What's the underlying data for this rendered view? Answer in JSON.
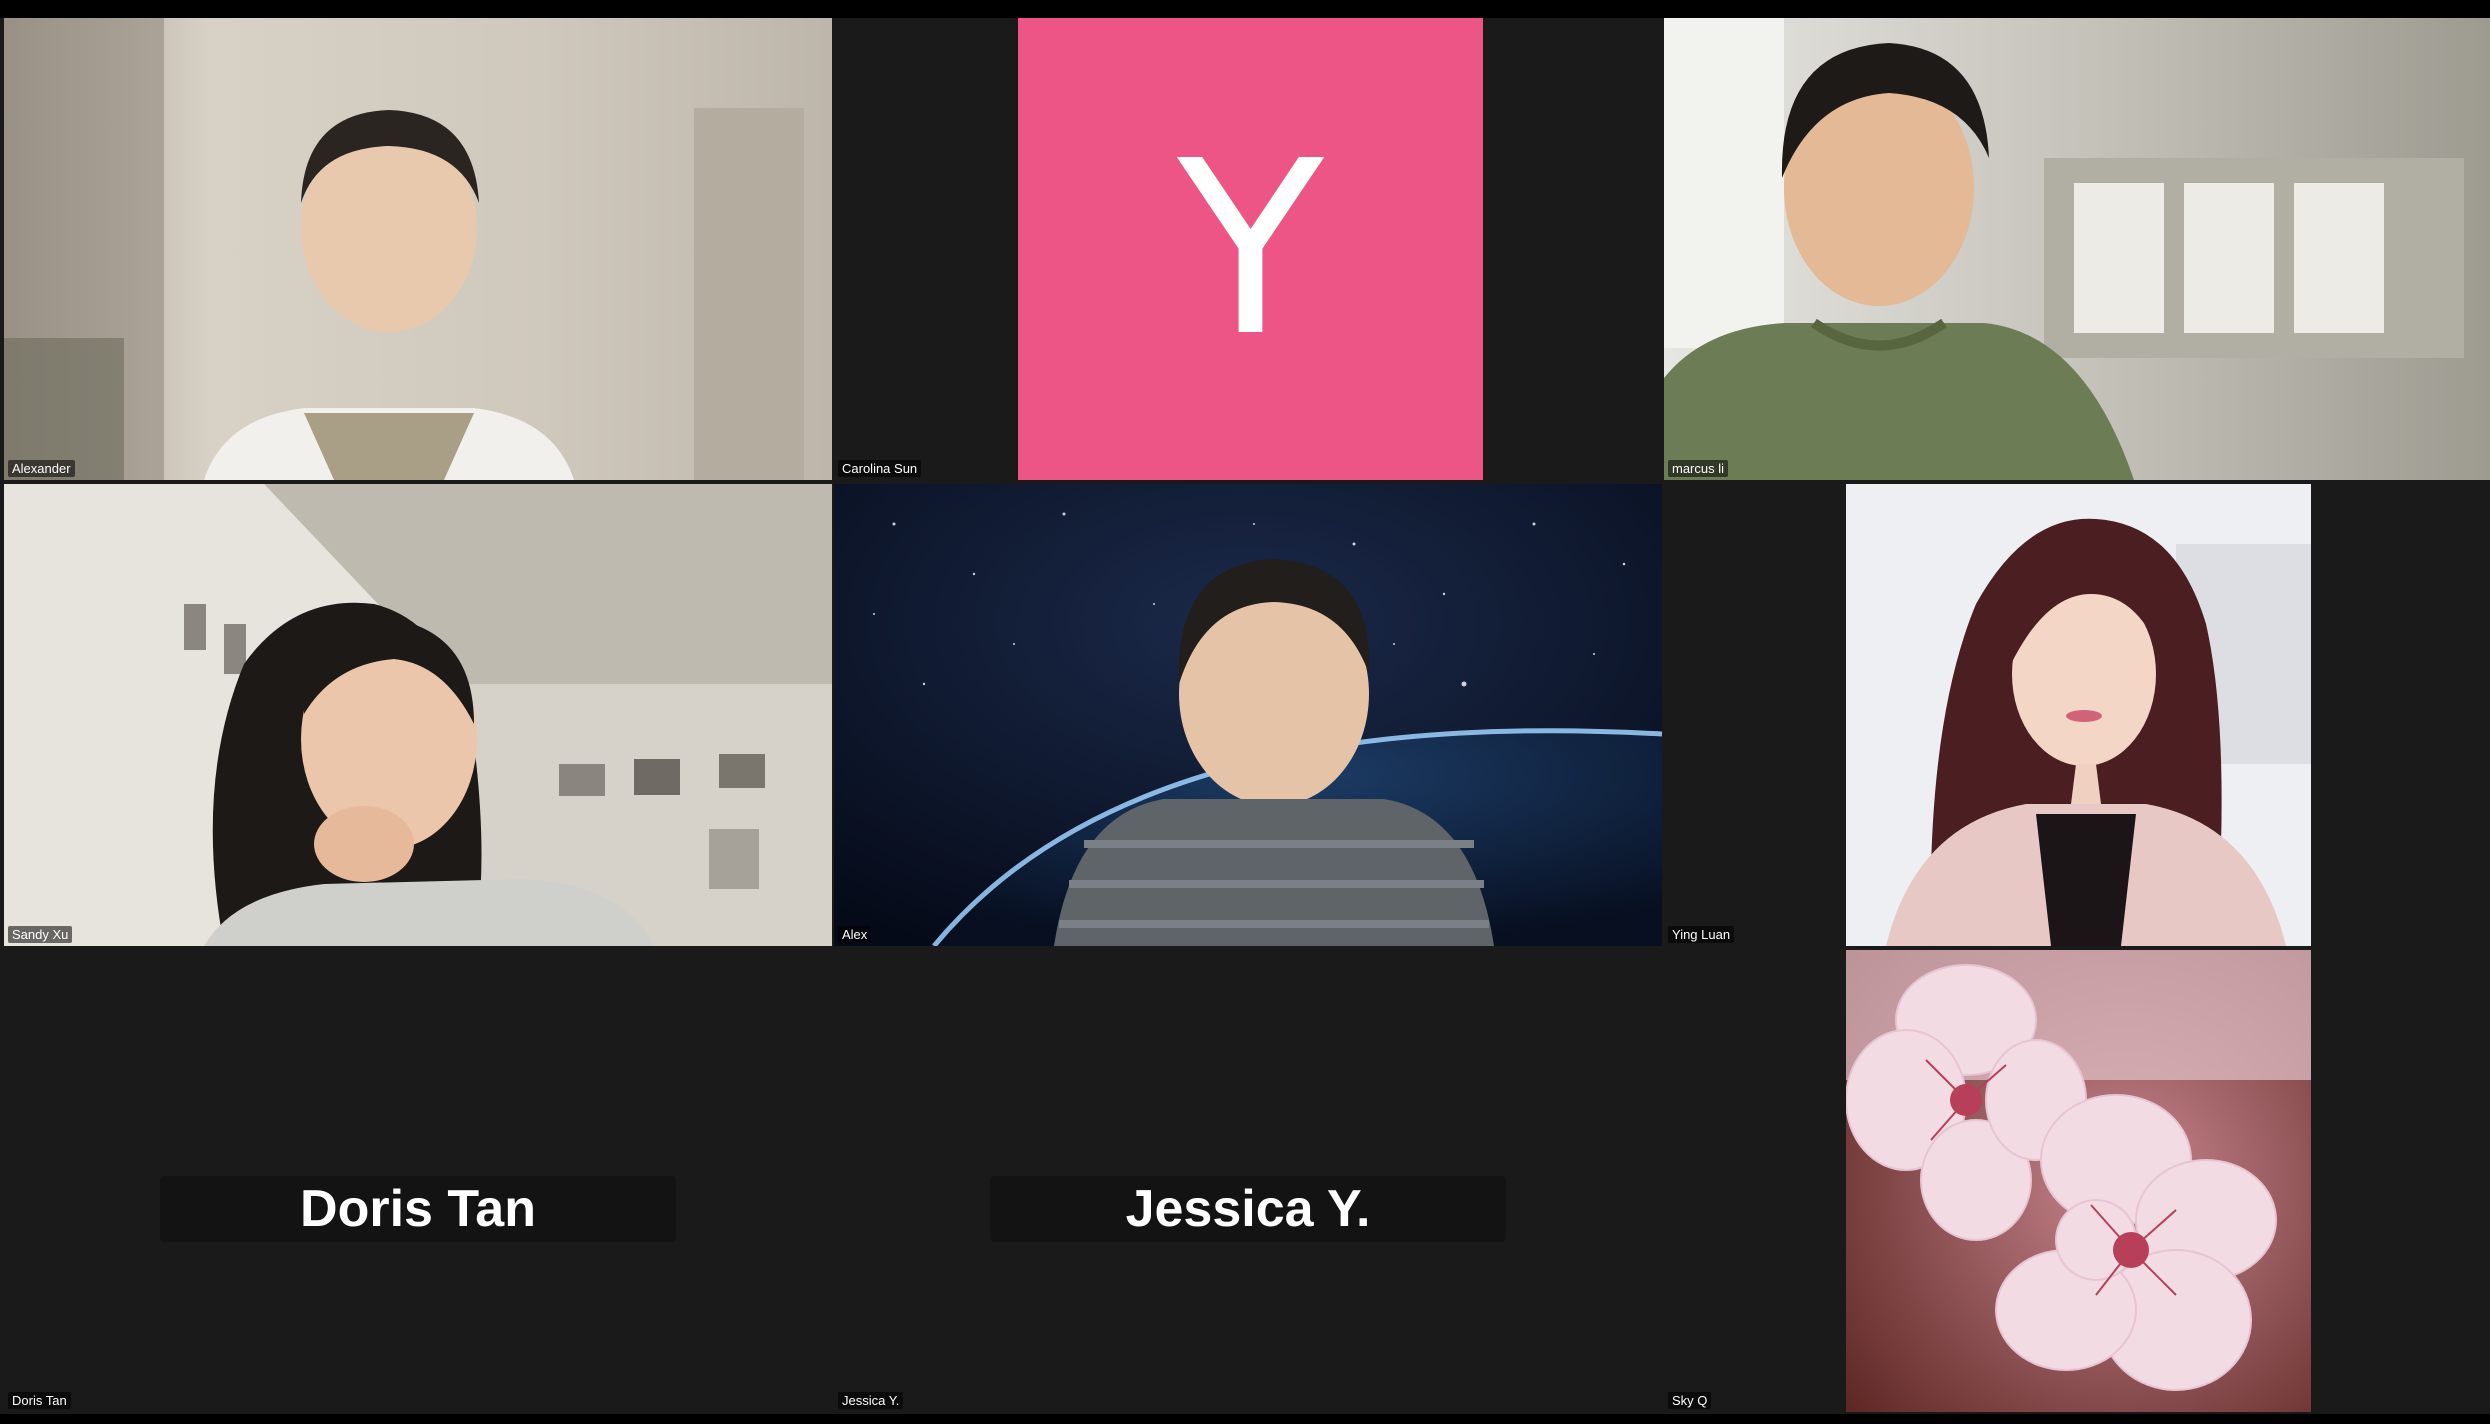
{
  "participants": [
    {
      "name": "Alexander",
      "video": "person-video"
    },
    {
      "name": "Carolina Sun",
      "avatar_letter": "Y",
      "avatar_color": "#ee5587"
    },
    {
      "name": "marcus li",
      "video": "person-video"
    },
    {
      "name": "Sandy Xu",
      "video": "person-video"
    },
    {
      "name": "Alex",
      "video": "person-video-space-background"
    },
    {
      "name": "Ying Luan",
      "video": "profile-photo"
    },
    {
      "name": "Doris Tan",
      "display_name": "Doris Tan",
      "video": "off"
    },
    {
      "name": "Jessica Y.",
      "display_name": "Jessica Y.",
      "video": "off"
    },
    {
      "name": "Sky Q",
      "video": "cherry-blossom-photo"
    }
  ],
  "colors": {
    "gallery_background": "#1a1a1a",
    "top_bar": "#000000",
    "avatar_pink": "#ee5587"
  }
}
